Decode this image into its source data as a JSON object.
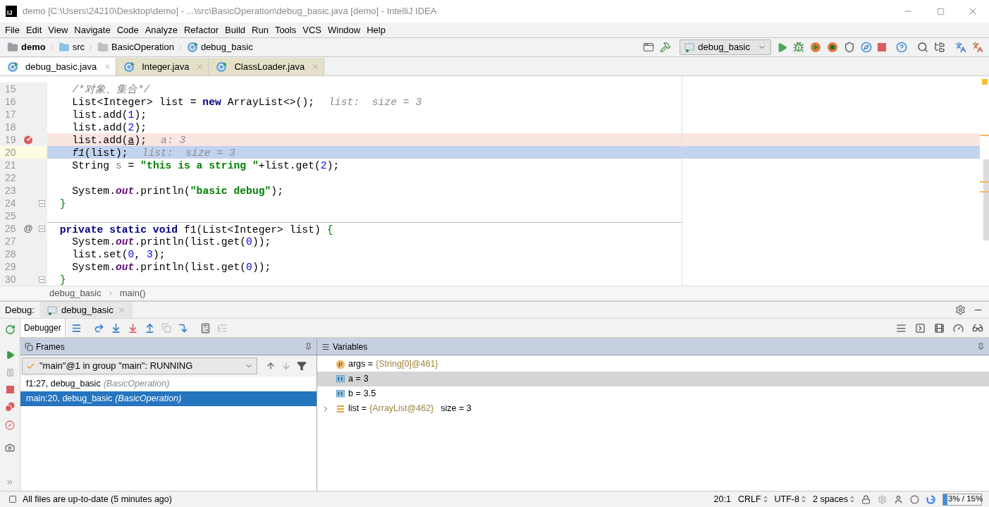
{
  "window": {
    "logo": "IJ",
    "title": "demo [C:\\Users\\24210\\Desktop\\demo] - ...\\src\\BasicOperation\\debug_basic.java [demo] - IntelliJ IDEA"
  },
  "menu": [
    "File",
    "Edit",
    "View",
    "Navigate",
    "Code",
    "Analyze",
    "Refactor",
    "Build",
    "Run",
    "Tools",
    "VCS",
    "Window",
    "Help"
  ],
  "breadcrumbs": [
    {
      "label": "demo",
      "kind": "project"
    },
    {
      "label": "src",
      "kind": "folder"
    },
    {
      "label": "BasicOperation",
      "kind": "package"
    },
    {
      "label": "debug_basic",
      "kind": "class"
    }
  ],
  "run_config": {
    "label": "debug_basic"
  },
  "editor_tabs": [
    {
      "label": "debug_basic.java",
      "selected": true
    },
    {
      "label": "Integer.java",
      "selected": false
    },
    {
      "label": "ClassLoader.java",
      "selected": false
    }
  ],
  "code_lines": [
    {
      "number": "15",
      "selected": false,
      "breakpoint": false,
      "fold": false,
      "separator": false,
      "tokens": [
        {
          "t": "    /*对象、集合*/",
          "kind": "comment"
        }
      ]
    },
    {
      "number": "16",
      "selected": false,
      "breakpoint": false,
      "fold": false,
      "separator": false,
      "tokens": [
        {
          "t": "    List<Integer> list = ",
          "kind": "plain"
        },
        {
          "t": "new",
          "kind": "keyword"
        },
        {
          "t": " ArrayList<>();",
          "kind": "plain"
        },
        {
          "t": "list:  size = 3",
          "kind": "hint"
        }
      ]
    },
    {
      "number": "17",
      "selected": false,
      "breakpoint": false,
      "fold": false,
      "separator": false,
      "tokens": [
        {
          "t": "    list.add(",
          "kind": "plain"
        },
        {
          "t": "1",
          "kind": "number"
        },
        {
          "t": ");",
          "kind": "plain"
        }
      ]
    },
    {
      "number": "18",
      "selected": false,
      "breakpoint": false,
      "fold": false,
      "separator": false,
      "tokens": [
        {
          "t": "    list.add(",
          "kind": "plain"
        },
        {
          "t": "2",
          "kind": "number"
        },
        {
          "t": ");",
          "kind": "plain"
        }
      ]
    },
    {
      "number": "19",
      "selected": false,
      "breakpoint": true,
      "fold": false,
      "separator": false,
      "tokens": [
        {
          "t": "    list.add(",
          "kind": "plain"
        },
        {
          "t": "a",
          "kind": "underline"
        },
        {
          "t": ");",
          "kind": "plain"
        },
        {
          "t": "a: 3",
          "kind": "hint"
        }
      ]
    },
    {
      "number": "20",
      "selected": true,
      "breakpoint": false,
      "fold": false,
      "separator": false,
      "tokens": [
        {
          "t": "    f1",
          "kind": "italic"
        },
        {
          "t": "(list);",
          "kind": "plain"
        },
        {
          "t": "list:  size = 3",
          "kind": "hint"
        }
      ]
    },
    {
      "number": "21",
      "selected": false,
      "breakpoint": false,
      "fold": false,
      "separator": false,
      "tokens": [
        {
          "t": "    String ",
          "kind": "plain"
        },
        {
          "t": "s",
          "kind": "unused"
        },
        {
          "t": " = ",
          "kind": "plain"
        },
        {
          "t": "\"this is a string \"",
          "kind": "string"
        },
        {
          "t": "+list.get(",
          "kind": "plain"
        },
        {
          "t": "2",
          "kind": "number"
        },
        {
          "t": ");",
          "kind": "plain"
        }
      ]
    },
    {
      "number": "22",
      "selected": false,
      "breakpoint": false,
      "fold": false,
      "separator": false
    },
    {
      "number": "23",
      "selected": false,
      "breakpoint": false,
      "fold": false,
      "separator": false,
      "tokens": [
        {
          "t": "    System.",
          "kind": "plain"
        },
        {
          "t": "out",
          "kind": "field"
        },
        {
          "t": ".println(",
          "kind": "plain"
        },
        {
          "t": "\"basic debug\"",
          "kind": "string"
        },
        {
          "t": ");",
          "kind": "plain"
        }
      ]
    },
    {
      "number": "24",
      "selected": false,
      "breakpoint": false,
      "fold": true,
      "separator": false,
      "tokens": [
        {
          "t": "  }",
          "kind": "brace"
        }
      ]
    },
    {
      "number": "25",
      "selected": false,
      "breakpoint": false,
      "fold": false,
      "separator": false
    },
    {
      "number": "26",
      "selected": false,
      "breakpoint": false,
      "fold": true,
      "separator": true,
      "gutter_label": "@",
      "tokens": [
        {
          "t": "  private static void",
          "kind": "keyword"
        },
        {
          "t": " f1(List<Integer> list) ",
          "kind": "plain"
        },
        {
          "t": "{",
          "kind": "brace"
        }
      ]
    },
    {
      "number": "27",
      "selected": false,
      "breakpoint": false,
      "fold": false,
      "separator": false,
      "tokens": [
        {
          "t": "    System.",
          "kind": "plain"
        },
        {
          "t": "out",
          "kind": "field"
        },
        {
          "t": ".println(list.get(",
          "kind": "plain"
        },
        {
          "t": "0",
          "kind": "number"
        },
        {
          "t": "));",
          "kind": "plain"
        }
      ]
    },
    {
      "number": "28",
      "selected": false,
      "breakpoint": false,
      "fold": false,
      "separator": false,
      "tokens": [
        {
          "t": "    list.set(",
          "kind": "plain"
        },
        {
          "t": "0",
          "kind": "number"
        },
        {
          "t": ", ",
          "kind": "plain"
        },
        {
          "t": "3",
          "kind": "number"
        },
        {
          "t": ");",
          "kind": "plain"
        }
      ]
    },
    {
      "number": "29",
      "selected": false,
      "breakpoint": false,
      "fold": false,
      "separator": false,
      "tokens": [
        {
          "t": "    System.",
          "kind": "plain"
        },
        {
          "t": "out",
          "kind": "field"
        },
        {
          "t": ".println(list.get(",
          "kind": "plain"
        },
        {
          "t": "0",
          "kind": "number"
        },
        {
          "t": "));",
          "kind": "plain"
        }
      ]
    },
    {
      "number": "30",
      "selected": false,
      "breakpoint": false,
      "fold": true,
      "separator": false,
      "tokens": [
        {
          "t": "  }",
          "kind": "brace"
        }
      ]
    }
  ],
  "editor_breadcrumbs": [
    "debug_basic",
    "main()"
  ],
  "debug": {
    "label": "Debug:",
    "tab": "debug_basic",
    "toolbar_tab": "Debugger",
    "frames": {
      "title": "Frames",
      "thread": "\"main\"@1 in group \"main\": RUNNING",
      "items": [
        {
          "method": "f1:27, debug_basic",
          "class": "(BasicOperation)",
          "selected": false
        },
        {
          "method": "main:20, debug_basic",
          "class": "(BasicOperation)",
          "selected": true
        }
      ]
    },
    "variables": {
      "title": "Variables",
      "items": [
        {
          "kind": "param",
          "name": "args =",
          "value": "{String[0]@461}",
          "reference": true,
          "expandable": false,
          "selected": false
        },
        {
          "kind": "primitive",
          "name": "a =",
          "value": "3",
          "reference": false,
          "expandable": false,
          "selected": true
        },
        {
          "kind": "primitive",
          "name": "b =",
          "value": "3.5",
          "reference": false,
          "expandable": false,
          "selected": false
        },
        {
          "kind": "list",
          "name": "list =",
          "value": "{ArrayList@462}",
          "extra": "size = 3",
          "reference": true,
          "expandable": true,
          "selected": false
        }
      ]
    }
  },
  "status_bar": {
    "message": "All files are up-to-date (5 minutes ago)",
    "position": "20:1",
    "line_ending": "CRLF",
    "encoding": "UTF-8",
    "indent": "2 spaces",
    "memory": "3% / 15%",
    "level": 0.12
  }
}
